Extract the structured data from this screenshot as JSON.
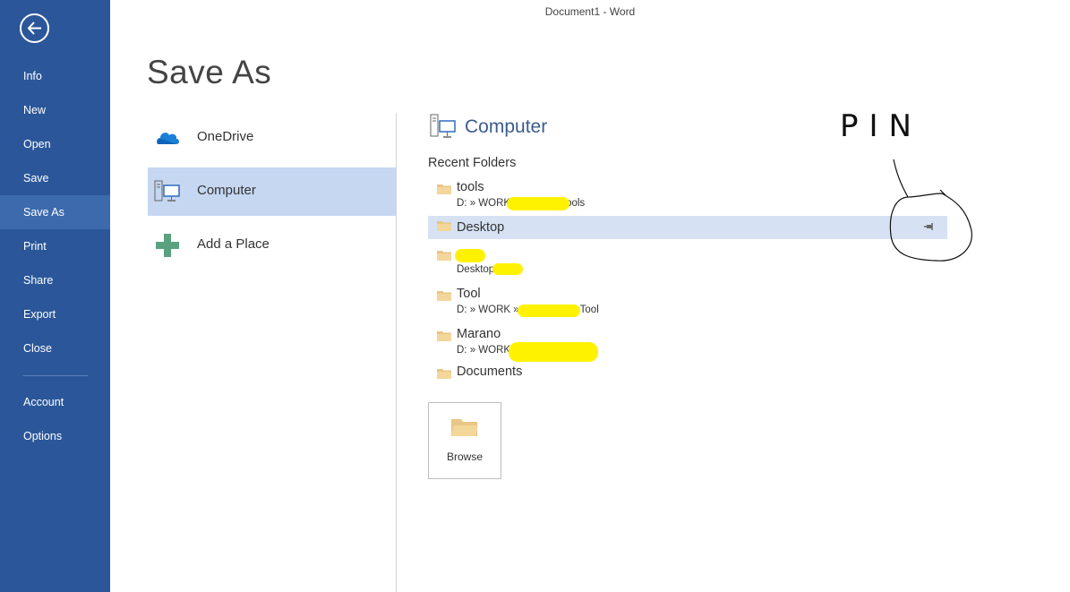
{
  "window": {
    "title": "Document1 - Word"
  },
  "sidebar": {
    "items": [
      {
        "label": "Info"
      },
      {
        "label": "New"
      },
      {
        "label": "Open"
      },
      {
        "label": "Save"
      },
      {
        "label": "Save As",
        "active": true
      },
      {
        "label": "Print"
      },
      {
        "label": "Share"
      },
      {
        "label": "Export"
      },
      {
        "label": "Close"
      },
      {
        "label": "Account"
      },
      {
        "label": "Options"
      }
    ]
  },
  "page": {
    "title": "Save As"
  },
  "places": [
    {
      "label": "OneDrive",
      "icon": "cloud-icon"
    },
    {
      "label": "Computer",
      "icon": "computer-icon",
      "selected": true
    },
    {
      "label": "Add a Place",
      "icon": "plus-icon"
    }
  ],
  "panel": {
    "title": "Computer",
    "recent_heading": "Recent Folders",
    "folders": [
      {
        "name": "tools",
        "path": "D: » WORK",
        "path_tail": "ools"
      },
      {
        "name": "Desktop",
        "path": "",
        "hover": true
      },
      {
        "name": "",
        "path": "Desktop",
        "path_tail": ""
      },
      {
        "name": "Tool",
        "path": "D: » WORK »",
        "path_tail": "Tool"
      },
      {
        "name": "Marano",
        "path": "D: » WORK",
        "path_tail": ""
      },
      {
        "name": "Documents",
        "path": ""
      }
    ],
    "browse_label": "Browse"
  },
  "annotation": {
    "text": "PIN"
  },
  "colors": {
    "sidebar": "#2b579a",
    "sidebar_active": "#3c6aad",
    "selected": "#c5d7f1",
    "hover": "#d6e2f3",
    "accent_text": "#3c5c8d",
    "folder": "#e8c685",
    "highlighter": "#fff200"
  }
}
